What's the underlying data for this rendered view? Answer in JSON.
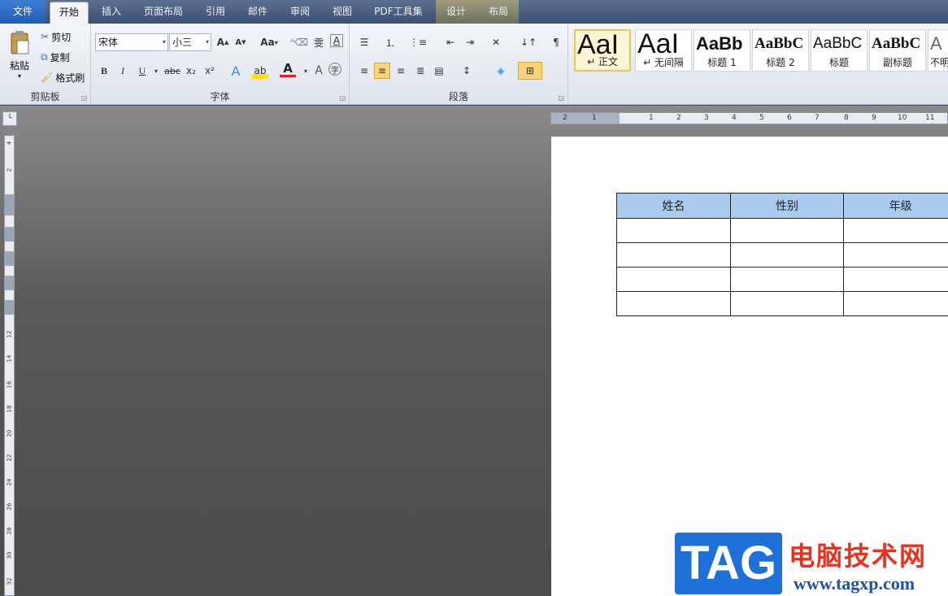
{
  "tabs": [
    {
      "label": "文件",
      "x": 0
    },
    {
      "label": "开始"
    },
    {
      "label": "插入"
    },
    {
      "label": "页面布局"
    },
    {
      "label": "引用"
    },
    {
      "label": "邮件"
    },
    {
      "label": "审阅"
    },
    {
      "label": "视图"
    },
    {
      "label": "PDF工具集"
    },
    {
      "label": "设计"
    },
    {
      "label": "布局"
    }
  ],
  "clipboard": {
    "paste": "粘贴",
    "cut": "剪切",
    "copy": "复制",
    "format_painter": "格式刷",
    "label": "剪贴板"
  },
  "font": {
    "name": "宋体",
    "size": "小三",
    "label": "字体",
    "bold": "B",
    "italic": "I",
    "underline": "U",
    "strike": "abc",
    "sub": "x₂",
    "sup": "x²",
    "grow": "A",
    "shrink": "A",
    "case": "Aa",
    "clear": "A",
    "color_a": "A"
  },
  "paragraph": {
    "label": "段落"
  },
  "styles": [
    {
      "preview": "AaI",
      "name": "↵ 正文"
    },
    {
      "preview": "AaI",
      "name": "↵ 无间隔"
    },
    {
      "preview": "AaBb",
      "name": "标题 1"
    },
    {
      "preview": "AaBbC",
      "name": "标题 2"
    },
    {
      "preview": "AaBbC",
      "name": "标题"
    },
    {
      "preview": "AaBbC",
      "name": "副标题"
    },
    {
      "preview": "A",
      "name": "不明"
    }
  ],
  "ruler_h": [
    "2",
    "1",
    "1",
    "2",
    "3",
    "4",
    "5",
    "6",
    "7",
    "8",
    "9",
    "10",
    "11"
  ],
  "ruler_v": [
    "4",
    "2",
    "2",
    "12",
    "14",
    "16",
    "18",
    "20",
    "22",
    "24",
    "26",
    "28",
    "30",
    "32"
  ],
  "table": {
    "headers": [
      "姓名",
      "性别",
      "年级"
    ],
    "rows": [
      [
        "",
        "",
        ""
      ],
      [
        "",
        "",
        ""
      ],
      [
        "",
        "",
        ""
      ],
      [
        "",
        "",
        ""
      ]
    ]
  },
  "watermark": {
    "tag": "TAG",
    "cn": "电脑技术网",
    "url": "www.tagxp.com"
  },
  "colors": {
    "header_fill": "#a9cbee",
    "accent": "#1f5cb5"
  }
}
